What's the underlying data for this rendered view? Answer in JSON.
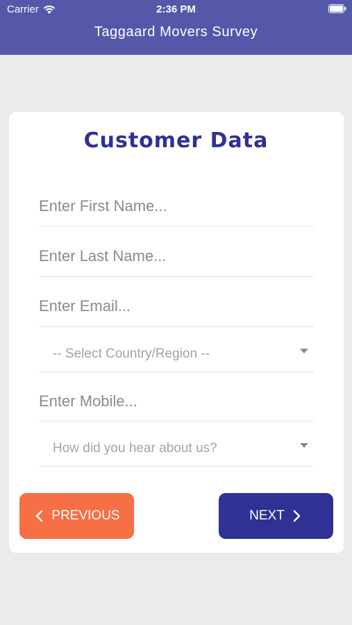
{
  "status_bar": {
    "carrier": "Carrier",
    "time": "2:36 PM"
  },
  "header": {
    "title": "Taggaard Movers Survey"
  },
  "form": {
    "title": "Customer Data",
    "first_name_placeholder": "Enter First Name...",
    "last_name_placeholder": "Enter Last Name...",
    "email_placeholder": "Enter Email...",
    "country_select": "-- Select Country/Region --",
    "mobile_placeholder": "Enter Mobile...",
    "referral_select": "How did you hear about us?"
  },
  "buttons": {
    "previous": "PREVIOUS",
    "next": "NEXT"
  },
  "colors": {
    "header_bg": "#5558a8",
    "title": "#2f3194",
    "previous_bg": "#f76f45",
    "next_bg": "#2f3194"
  },
  "icons": [
    "wifi-icon",
    "battery-icon",
    "chevron-left-icon",
    "chevron-right-icon",
    "caret-down-icon"
  ]
}
